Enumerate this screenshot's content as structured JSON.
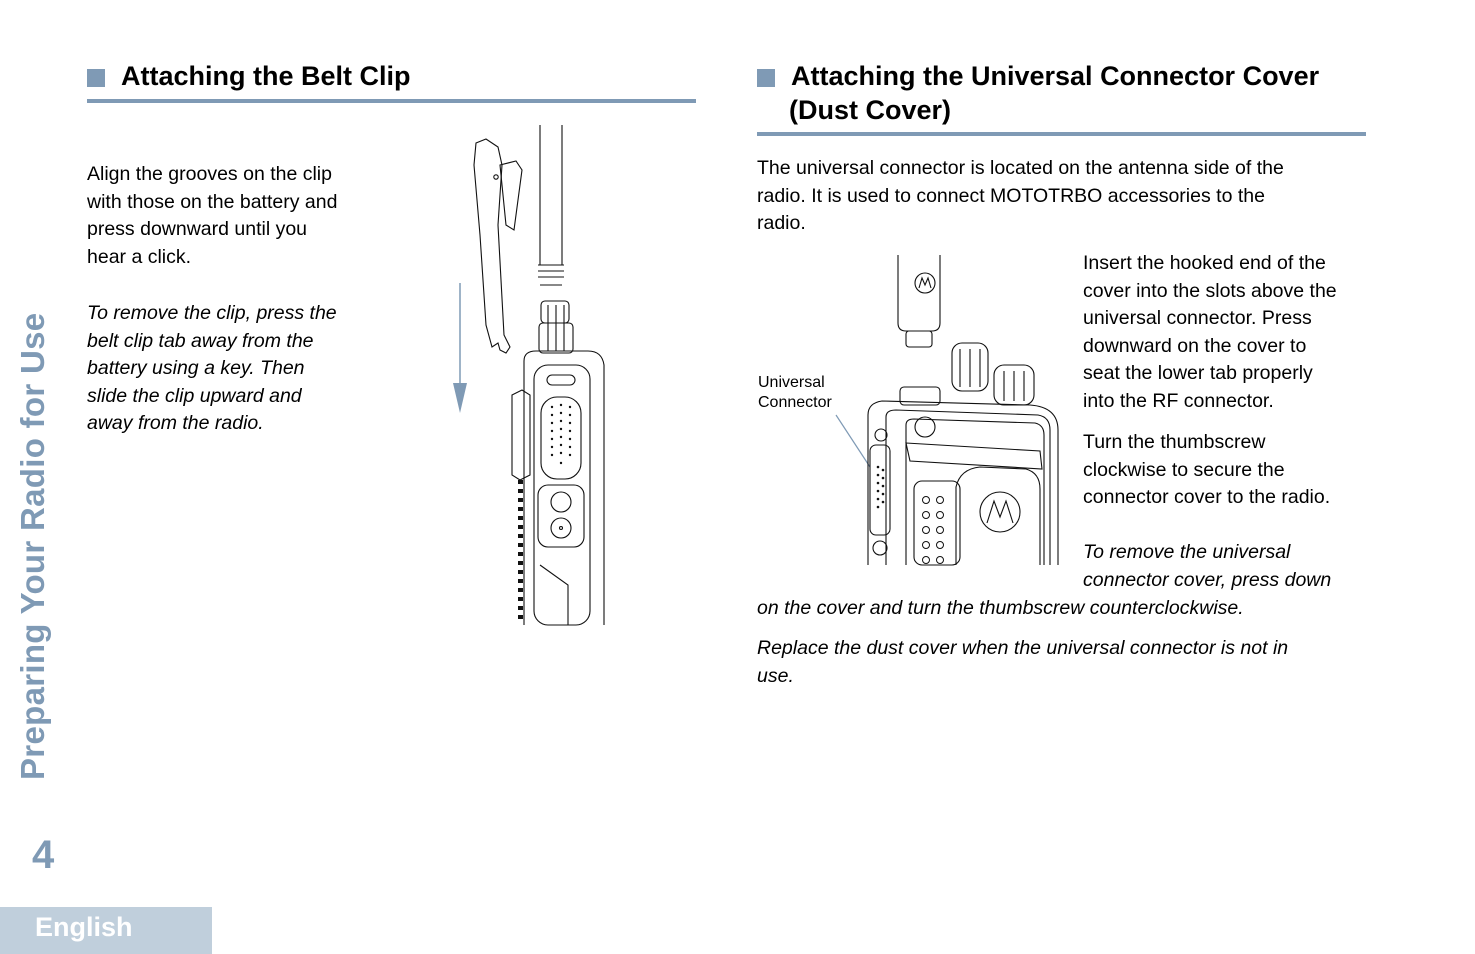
{
  "sidebar": {
    "chapter_title": "Preparing Your Radio for Use",
    "page_number": "4",
    "language_tab": "English"
  },
  "colors": {
    "accent": "#7f9ab5",
    "tab_background": "#c0cfdc",
    "text": "#000000"
  },
  "left_section": {
    "title": "Attaching the Belt Clip",
    "instruction": [
      "Align the grooves on the clip",
      "with those on the battery and",
      "press downward until you",
      "hear a click."
    ],
    "removal_note": [
      "To remove the clip, press the",
      "belt clip tab away from the",
      "battery using a key. Then",
      "slide the clip upward and",
      "away from the radio."
    ],
    "figure": {
      "description": "Belt clip being slid downward onto radio battery",
      "arrow": "down-arrow"
    }
  },
  "right_section": {
    "title_line1": "Attaching the Universal Connector Cover",
    "title_line2": "(Dust Cover)",
    "intro": [
      "The universal connector is located on the antenna side of the",
      "radio. It is used to connect MOTOTRBO accessories to the",
      "radio."
    ],
    "figure": {
      "callout_line1": "Universal",
      "callout_line2": "Connector",
      "description": "Radio top with dust cover above universal connector"
    },
    "step1": [
      "Insert the hooked end of the",
      "cover into the slots above the",
      "universal connector. Press",
      "downward on the cover to",
      "seat the lower tab properly",
      "into the RF connector."
    ],
    "step2": [
      "Turn the thumbscrew",
      "clockwise to secure the",
      "connector cover to the radio."
    ],
    "removal_note_wrapped": [
      "To remove the universal",
      "connector cover, press down"
    ],
    "removal_note_full": "on the cover and turn the thumbscrew counterclockwise.",
    "replace_note": [
      "Replace the dust cover when the universal connector is not in",
      "use."
    ]
  }
}
